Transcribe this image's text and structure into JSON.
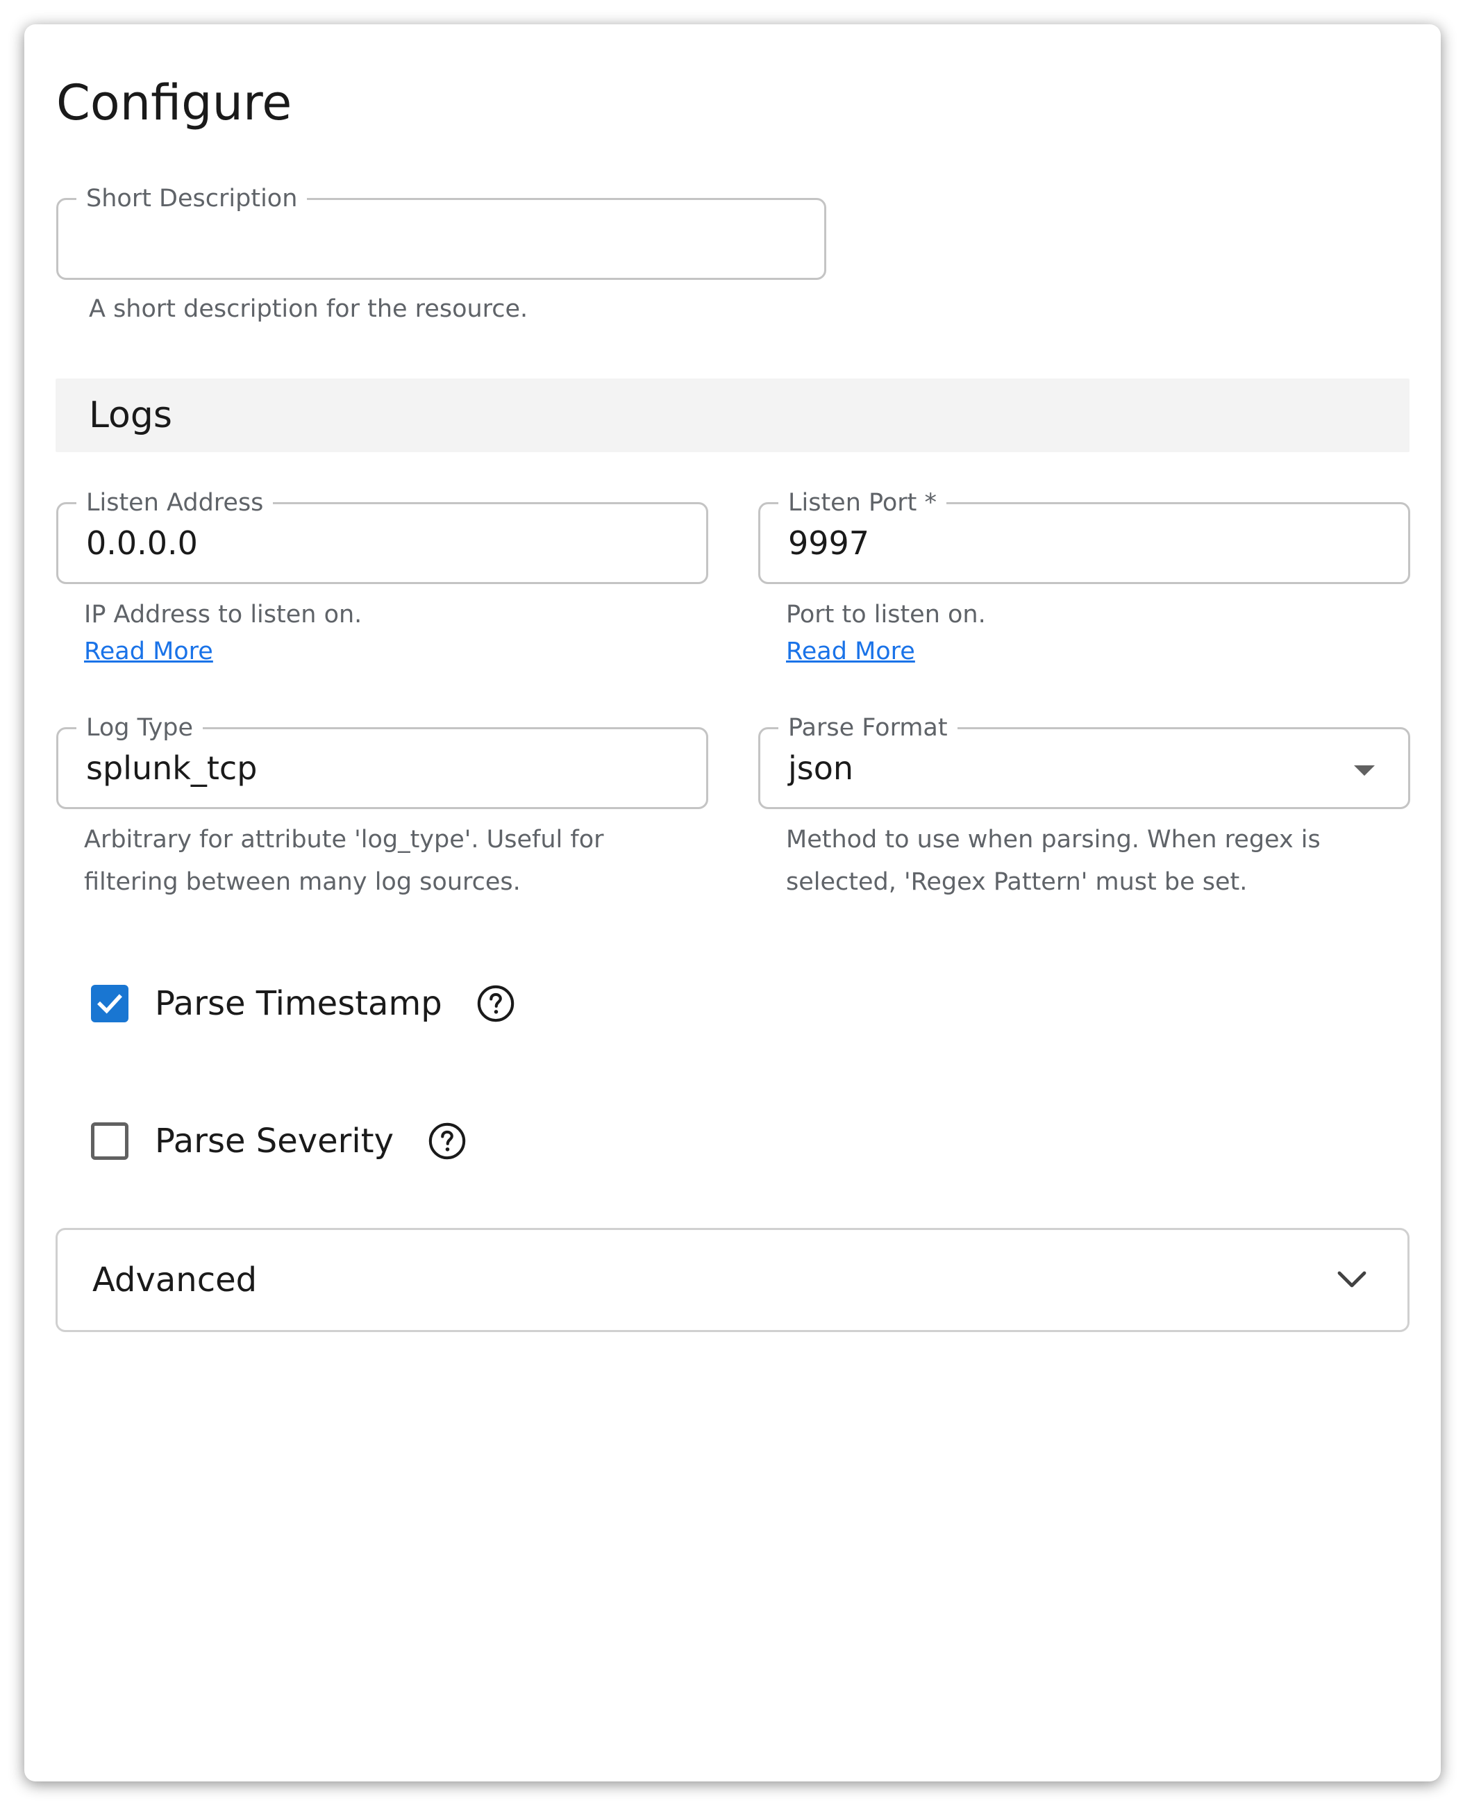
{
  "page": {
    "title": "Configure"
  },
  "short_description": {
    "label": "Short Description",
    "value": "",
    "helper": "A short description for the resource."
  },
  "logs_section": {
    "title": "Logs"
  },
  "listen_address": {
    "label": "Listen Address",
    "value": "0.0.0.0",
    "helper": "IP Address to listen on.",
    "link": "Read More"
  },
  "listen_port": {
    "label": "Listen Port *",
    "value": "9997",
    "helper": "Port to listen on.",
    "link": "Read More"
  },
  "log_type": {
    "label": "Log Type",
    "value": "splunk_tcp",
    "helper_line1": "Arbitrary for attribute 'log_type'. Useful for",
    "helper_line2": "filtering between many log sources."
  },
  "parse_format": {
    "label": "Parse Format",
    "value": "json",
    "helper_line1": "Method to use when parsing. When regex is",
    "helper_line2": "selected, 'Regex Pattern' must be set."
  },
  "parse_timestamp": {
    "label": "Parse Timestamp",
    "checked": true
  },
  "parse_severity": {
    "label": "Parse Severity",
    "checked": false
  },
  "advanced": {
    "title": "Advanced",
    "expanded": false
  },
  "colors": {
    "accent": "#1976d2",
    "link": "#1a73e8",
    "border": "#c4c4c4",
    "section_bg": "#f3f3f3",
    "helper_text": "#5f6368"
  },
  "icons": {
    "checkbox_checked": "check-icon",
    "help": "help-circle-icon",
    "dropdown": "caret-down-icon",
    "accordion": "chevron-down-icon"
  }
}
